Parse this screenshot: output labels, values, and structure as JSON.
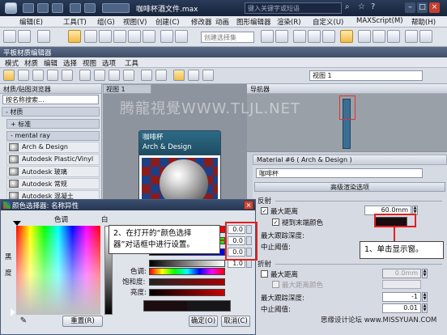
{
  "app": {
    "file_title": "咖啡杯酒文件.max",
    "search_placeholder": "键入关键字或短语",
    "window_controls": [
      "–",
      "□",
      "×"
    ],
    "menu": [
      "编辑(E)",
      "工具(T)",
      "组(G)",
      "视图(V)",
      "创建(C)",
      "修改器",
      "动画",
      "图形编辑器",
      "渲染(R)",
      "自定义(U)",
      "MAXScript(M)",
      "帮助(H)"
    ],
    "selection_set_placeholder": "创建选择集"
  },
  "slate": {
    "title": "平板材质编辑器",
    "menu": [
      "模式",
      "材质",
      "编辑",
      "选择",
      "视图",
      "选项",
      "工具"
    ],
    "view_select": "视图 1",
    "view_tab": "视图 1"
  },
  "browser": {
    "header": "材质/贴图浏览器",
    "search_placeholder": "按名称搜索...",
    "groups": {
      "materials": "- 材质",
      "standard": "+ 标准",
      "mental_ray": "- mental ray"
    },
    "items": [
      "Arch & Design",
      "Autodesk Plastic/Vinyl",
      "Autodesk 玻璃",
      "Autodesk 常规",
      "Autodesk 混凝土"
    ]
  },
  "node": {
    "title": "咖啡杯",
    "subtitle": "Arch & Design"
  },
  "navigator": {
    "header": "导航器"
  },
  "watermark": "腾龍視覺WWW.TLJL.NET",
  "params": {
    "header": "Material #6 ( Arch & Design )",
    "material_name": "咖啡杯",
    "rollout": "高级渲染选项",
    "reflection": {
      "section": "反射",
      "max_distance_label": "最大距离",
      "max_distance_value": "60.0mm",
      "fade_label": "褪到末端颜色",
      "max_depth_label": "最大跟踪深度:",
      "cutoff_label": "中止阈值:"
    },
    "refraction": {
      "section": "折射",
      "max_distance_label": "最大距离",
      "max_distance_value": "0.0mm",
      "color_label": "最大距离颜色",
      "max_depth_label": "最大跟踪深度:",
      "max_depth_value": "-1",
      "cutoff_label": "中止阈值:",
      "cutoff_value": "0.01"
    }
  },
  "dialog": {
    "title": "颜色选择器: 名称异性",
    "hue_label": "色调",
    "whiteness_label": "白",
    "blackness_label": "黑",
    "degree_label": "度",
    "rgb_values": [
      "0.0",
      "0.0",
      "0.0",
      "1.0"
    ],
    "hsv_labels": [
      "色调:",
      "饱和度:",
      "亮度:"
    ],
    "reset_label": "重置(R)",
    "ok_label": "确定(O)",
    "cancel_label": "取消(C)"
  },
  "callouts": {
    "step1": "1、单击显示窗。",
    "step2_line1": "2、在打开的“颜色选择",
    "step2_line2": "器”对话框中进行设置。"
  },
  "site_mark": "思缘设计论坛 www.MISSYUAN.COM",
  "colors": {
    "selected_color": "#1a0c0f",
    "highlight": "#e02020",
    "node_header": "#2d6b86"
  }
}
